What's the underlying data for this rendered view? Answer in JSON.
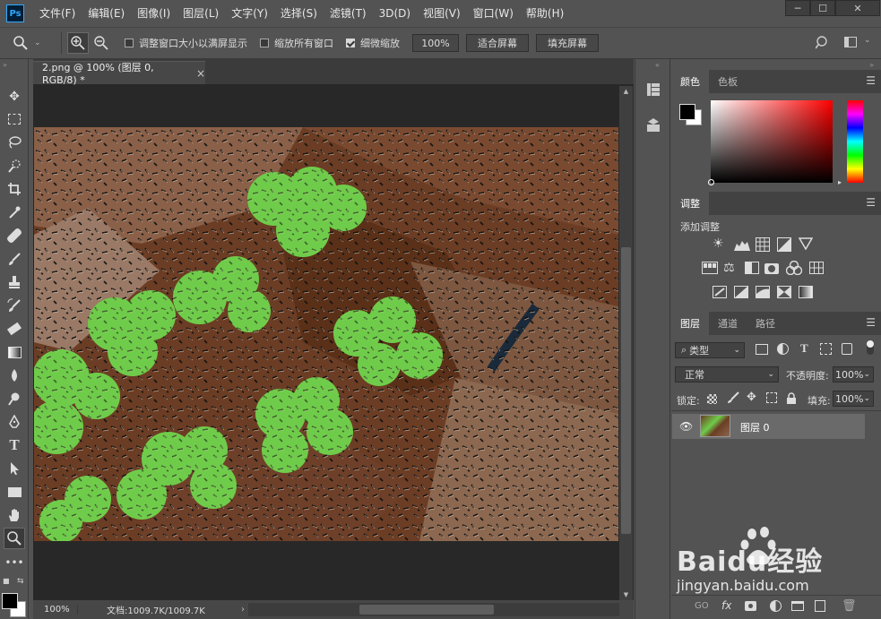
{
  "app": {
    "logo": "Ps"
  },
  "menu": [
    "文件(F)",
    "编辑(E)",
    "图像(I)",
    "图层(L)",
    "文字(Y)",
    "选择(S)",
    "滤镜(T)",
    "3D(D)",
    "视图(V)",
    "窗口(W)",
    "帮助(H)"
  ],
  "window_controls": {
    "minimize": "─",
    "maximize": "☐",
    "close": "✕"
  },
  "options": {
    "resize_windows": "调整窗口大小以满屏显示",
    "zoom_all_windows": "缩放所有窗口",
    "scrubby_zoom": "细微缩放",
    "scrubby_zoom_checked": true,
    "zoom_value": "100%",
    "fit_screen": "适合屏幕",
    "fill_screen": "填充屏幕"
  },
  "document": {
    "tab_title": "2.png @ 100% (图层 0, RGB/8) *",
    "close": "×"
  },
  "status": {
    "zoom": "100%",
    "doc_info": "文档:1009.7K/1009.7K",
    "arrow": "›"
  },
  "panels": {
    "color": {
      "tabs": [
        "颜色",
        "色板"
      ],
      "fg": "#000000",
      "bg": "#ffffff",
      "hue": "#ff0000"
    },
    "adjustments": {
      "tab": "调整",
      "add_label": "添加调整"
    },
    "layers": {
      "tabs": [
        "图层",
        "通道",
        "路径"
      ],
      "filter_kind": "类型",
      "blend_mode": "正常",
      "opacity_label": "不透明度:",
      "opacity": "100%",
      "lock_label": "锁定:",
      "fill_label": "填充:",
      "fill": "100%",
      "layer_name": "图层 0",
      "footer_icons": [
        "GO",
        "fx"
      ]
    }
  },
  "watermark": {
    "brand": "Baidu经验",
    "url": "jingyan.baidu.com"
  }
}
